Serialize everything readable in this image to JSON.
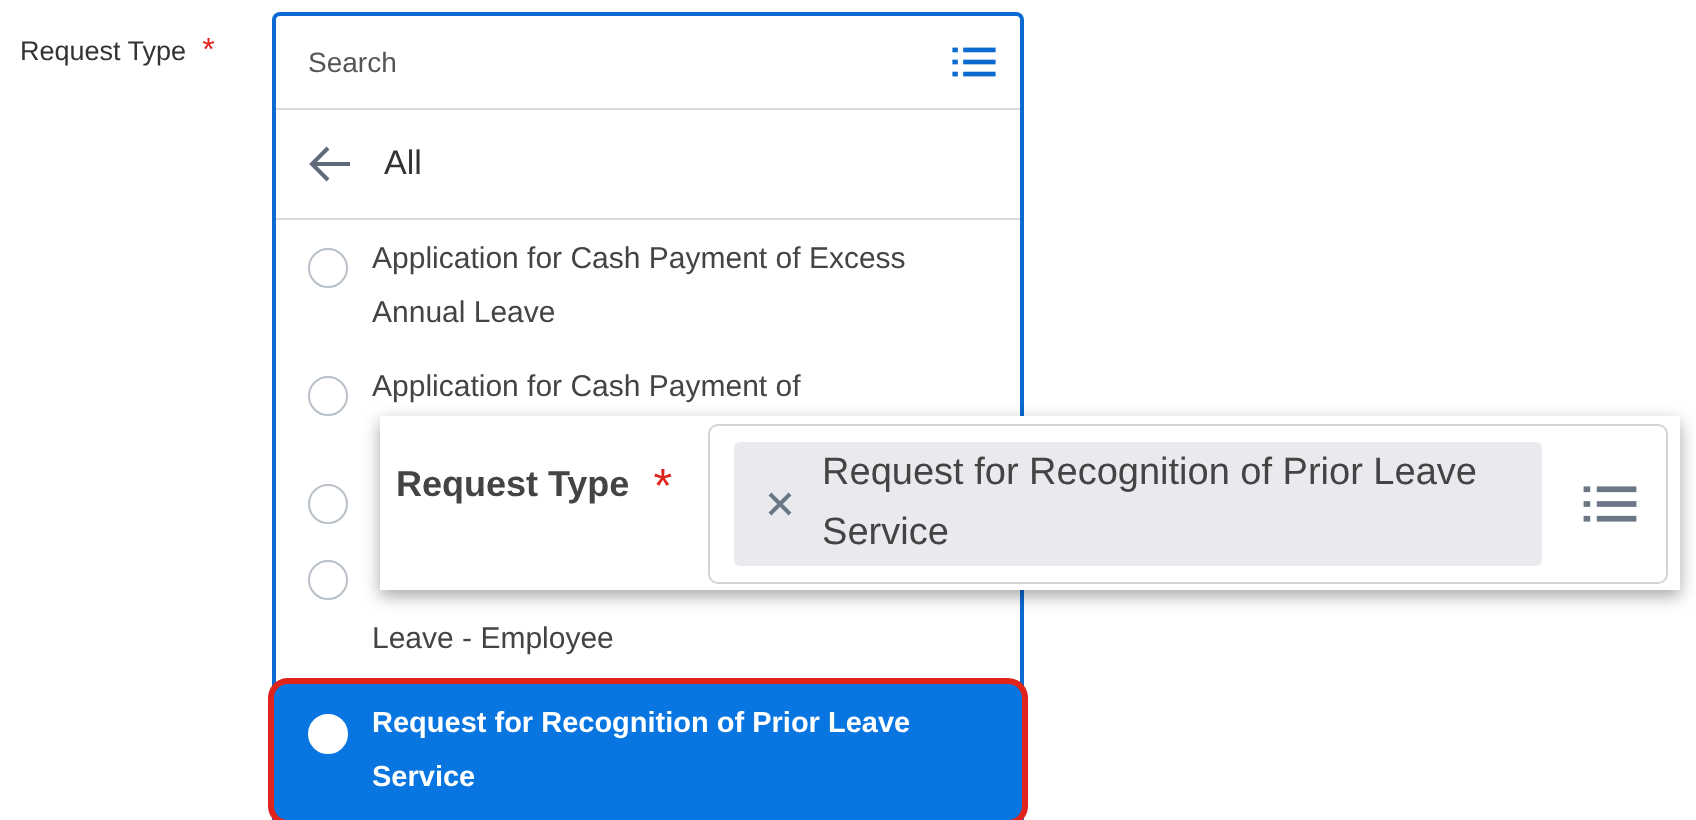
{
  "form_label": {
    "text": "Request Type",
    "required": true,
    "required_mark": "*"
  },
  "dropdown": {
    "search": {
      "placeholder": "Search"
    },
    "back": {
      "label": "All"
    },
    "options": [
      {
        "kind": "normal",
        "label": "Application for Cash Payment of Excess Annual Leave",
        "selected": false,
        "highlighted": false
      },
      {
        "kind": "normal",
        "label": "Application for Cash Payment of",
        "selected": false,
        "highlighted": false
      },
      {
        "kind": "covered",
        "selected": false,
        "highlighted": false
      },
      {
        "kind": "continued",
        "label": "Leave - Employee",
        "selected": false,
        "highlighted": false
      },
      {
        "kind": "normal",
        "label": "Request for Recognition of Prior Leave Service",
        "selected": true,
        "highlighted": true
      }
    ]
  },
  "zoom_callout": {
    "label": "Request Type",
    "required": true,
    "required_mark": "*",
    "chip": {
      "label": "Request for Recognition of Prior Leave Service"
    }
  }
}
